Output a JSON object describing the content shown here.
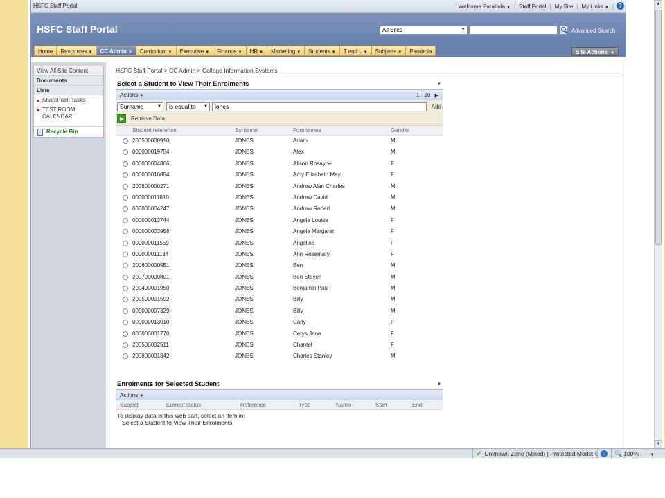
{
  "topbar": {
    "site_name": "HSFC Staff Portal",
    "welcome": "Welcome Parabola",
    "links": [
      "Staff Portal",
      "My Site",
      "My Links"
    ]
  },
  "header": {
    "title": "HSFC Staff Portal",
    "search_scope": "All Sites",
    "advanced_search": "Advanced Search"
  },
  "nav": {
    "tabs": [
      {
        "label": "Home",
        "dropdown": false,
        "selected": false
      },
      {
        "label": "Resources",
        "dropdown": true,
        "selected": false
      },
      {
        "label": "CC Admin",
        "dropdown": true,
        "selected": true
      },
      {
        "label": "Curriculum",
        "dropdown": true,
        "selected": false
      },
      {
        "label": "Executive",
        "dropdown": true,
        "selected": false
      },
      {
        "label": "Finance",
        "dropdown": true,
        "selected": false
      },
      {
        "label": "HR",
        "dropdown": true,
        "selected": false
      },
      {
        "label": "Marketing",
        "dropdown": true,
        "selected": false
      },
      {
        "label": "Students",
        "dropdown": true,
        "selected": false
      },
      {
        "label": "T and L",
        "dropdown": true,
        "selected": false
      },
      {
        "label": "Subjects",
        "dropdown": true,
        "selected": false
      },
      {
        "label": "Parabola",
        "dropdown": false,
        "selected": false
      }
    ],
    "site_actions": "Site Actions"
  },
  "leftnav": {
    "view_all": "View All Site Content",
    "documents": "Documents",
    "lists": "Lists",
    "list_items": [
      "SharePoint Tasks",
      "TEST ROOM CALENDAR"
    ],
    "recycle_bin": "Recycle Bin"
  },
  "breadcrumb": "HSFC Staff Portal > CC Admin > College Information Systems",
  "students_part": {
    "title": "Select a Student to View Their Enrolments",
    "actions": "Actions",
    "paging": "1 - 20",
    "filter": {
      "field": "Surname",
      "operator": "is equal to",
      "value": "jones",
      "add": "Add"
    },
    "retrieve": "Retrieve Data",
    "columns": [
      "Student reference",
      "Surname",
      "Forenames",
      "Gender"
    ],
    "rows": [
      [
        "200500000910",
        "JONES",
        "Adam",
        "M"
      ],
      [
        "000000019754",
        "JONES",
        "Alex",
        "M"
      ],
      [
        "000000004866",
        "JONES",
        "Alison Rosayne",
        "F"
      ],
      [
        "000000016854",
        "JONES",
        "Amy Elizabeth May",
        "F"
      ],
      [
        "200800000271",
        "JONES",
        "Andrew Alan Charles",
        "M"
      ],
      [
        "000000011810",
        "JONES",
        "Andrew David",
        "M"
      ],
      [
        "000000004247",
        "JONES",
        "Andrew Robert",
        "M"
      ],
      [
        "000000012744",
        "JONES",
        "Angela Louise",
        "F"
      ],
      [
        "000000003958",
        "JONES",
        "Angela Margaret",
        "F"
      ],
      [
        "000000011559",
        "JONES",
        "Angelina",
        "F"
      ],
      [
        "000000011134",
        "JONES",
        "Ann Rosemary",
        "F"
      ],
      [
        "200600000551",
        "JONES",
        "Ben",
        "M"
      ],
      [
        "200700000801",
        "JONES",
        "Ben Steven",
        "M"
      ],
      [
        "200400001950",
        "JONES",
        "Benjamin Paul",
        "M"
      ],
      [
        "200500001592",
        "JONES",
        "Billy",
        "M"
      ],
      [
        "000000007329",
        "JONES",
        "Billy",
        "M"
      ],
      [
        "000000013010",
        "JONES",
        "Carly",
        "F"
      ],
      [
        "000000001770",
        "JONES",
        "Cerys Jane",
        "F"
      ],
      [
        "200500002511",
        "JONES",
        "Chantel",
        "F"
      ],
      [
        "200800001342",
        "JONES",
        "Charles Stanley",
        "M"
      ]
    ]
  },
  "enrolments_part": {
    "title": "Enrolments for Selected Student",
    "actions": "Actions",
    "columns": [
      "Subject",
      "Current status",
      "Reference",
      "Type",
      "Name",
      "Start",
      "End"
    ],
    "message_line1": "To display data in this web part, select an item in:",
    "message_line2": "Select a Student to View Their Enrolments"
  },
  "statusbar": {
    "zone": "Unknown Zone (Mixed) | Protected Mode: On",
    "zoom": "100%"
  }
}
